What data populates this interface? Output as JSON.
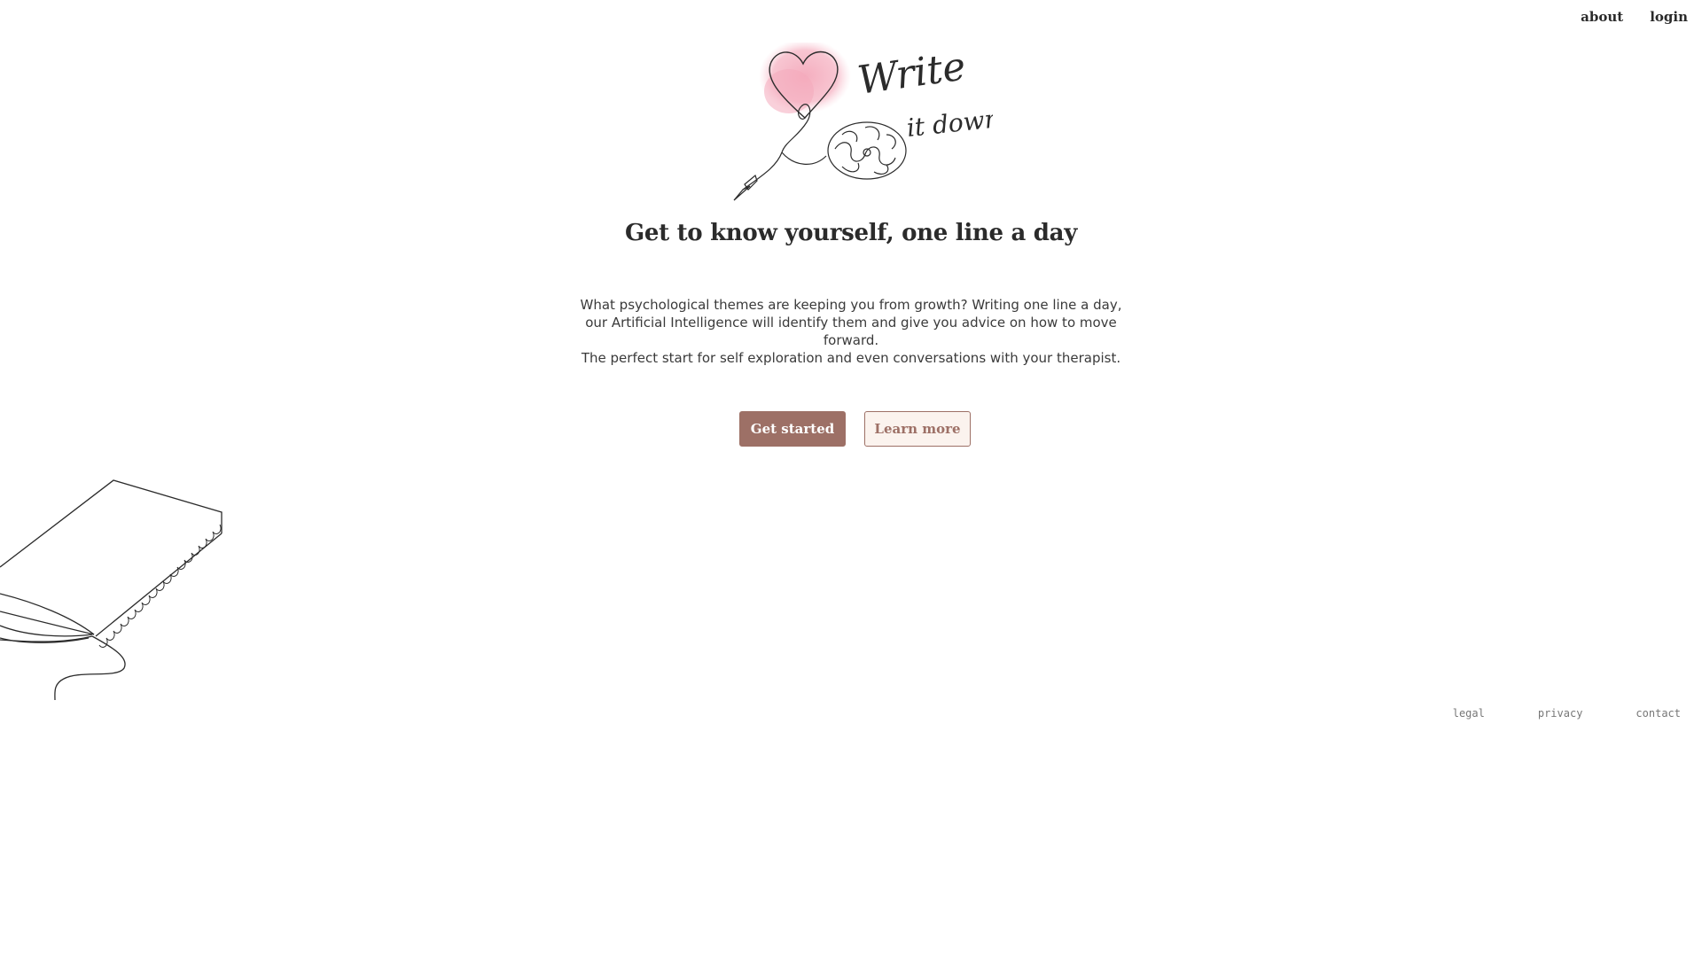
{
  "nav": {
    "about_label": "about",
    "login_label": "login"
  },
  "logo": {
    "text_line1": "Write",
    "text_line2": "it down"
  },
  "hero": {
    "headline": "Get to know yourself, one line a day",
    "description": "What psychological themes are keeping you from growth? Writing one line a day, our Artificial Intelligence will identify them and give you advice on how to move forward.",
    "subdescription": "The perfect start for self exploration and even conversations with your therapist."
  },
  "actions": {
    "primary_label": "Get started",
    "secondary_label": "Learn more"
  },
  "footer": {
    "legal_label": "legal",
    "privacy_label": "privacy",
    "contact_label": "contact"
  },
  "colors": {
    "accent": "#9d7066",
    "accent_light": "#fbf3ee",
    "logo_pink": "#f2a6b8"
  }
}
